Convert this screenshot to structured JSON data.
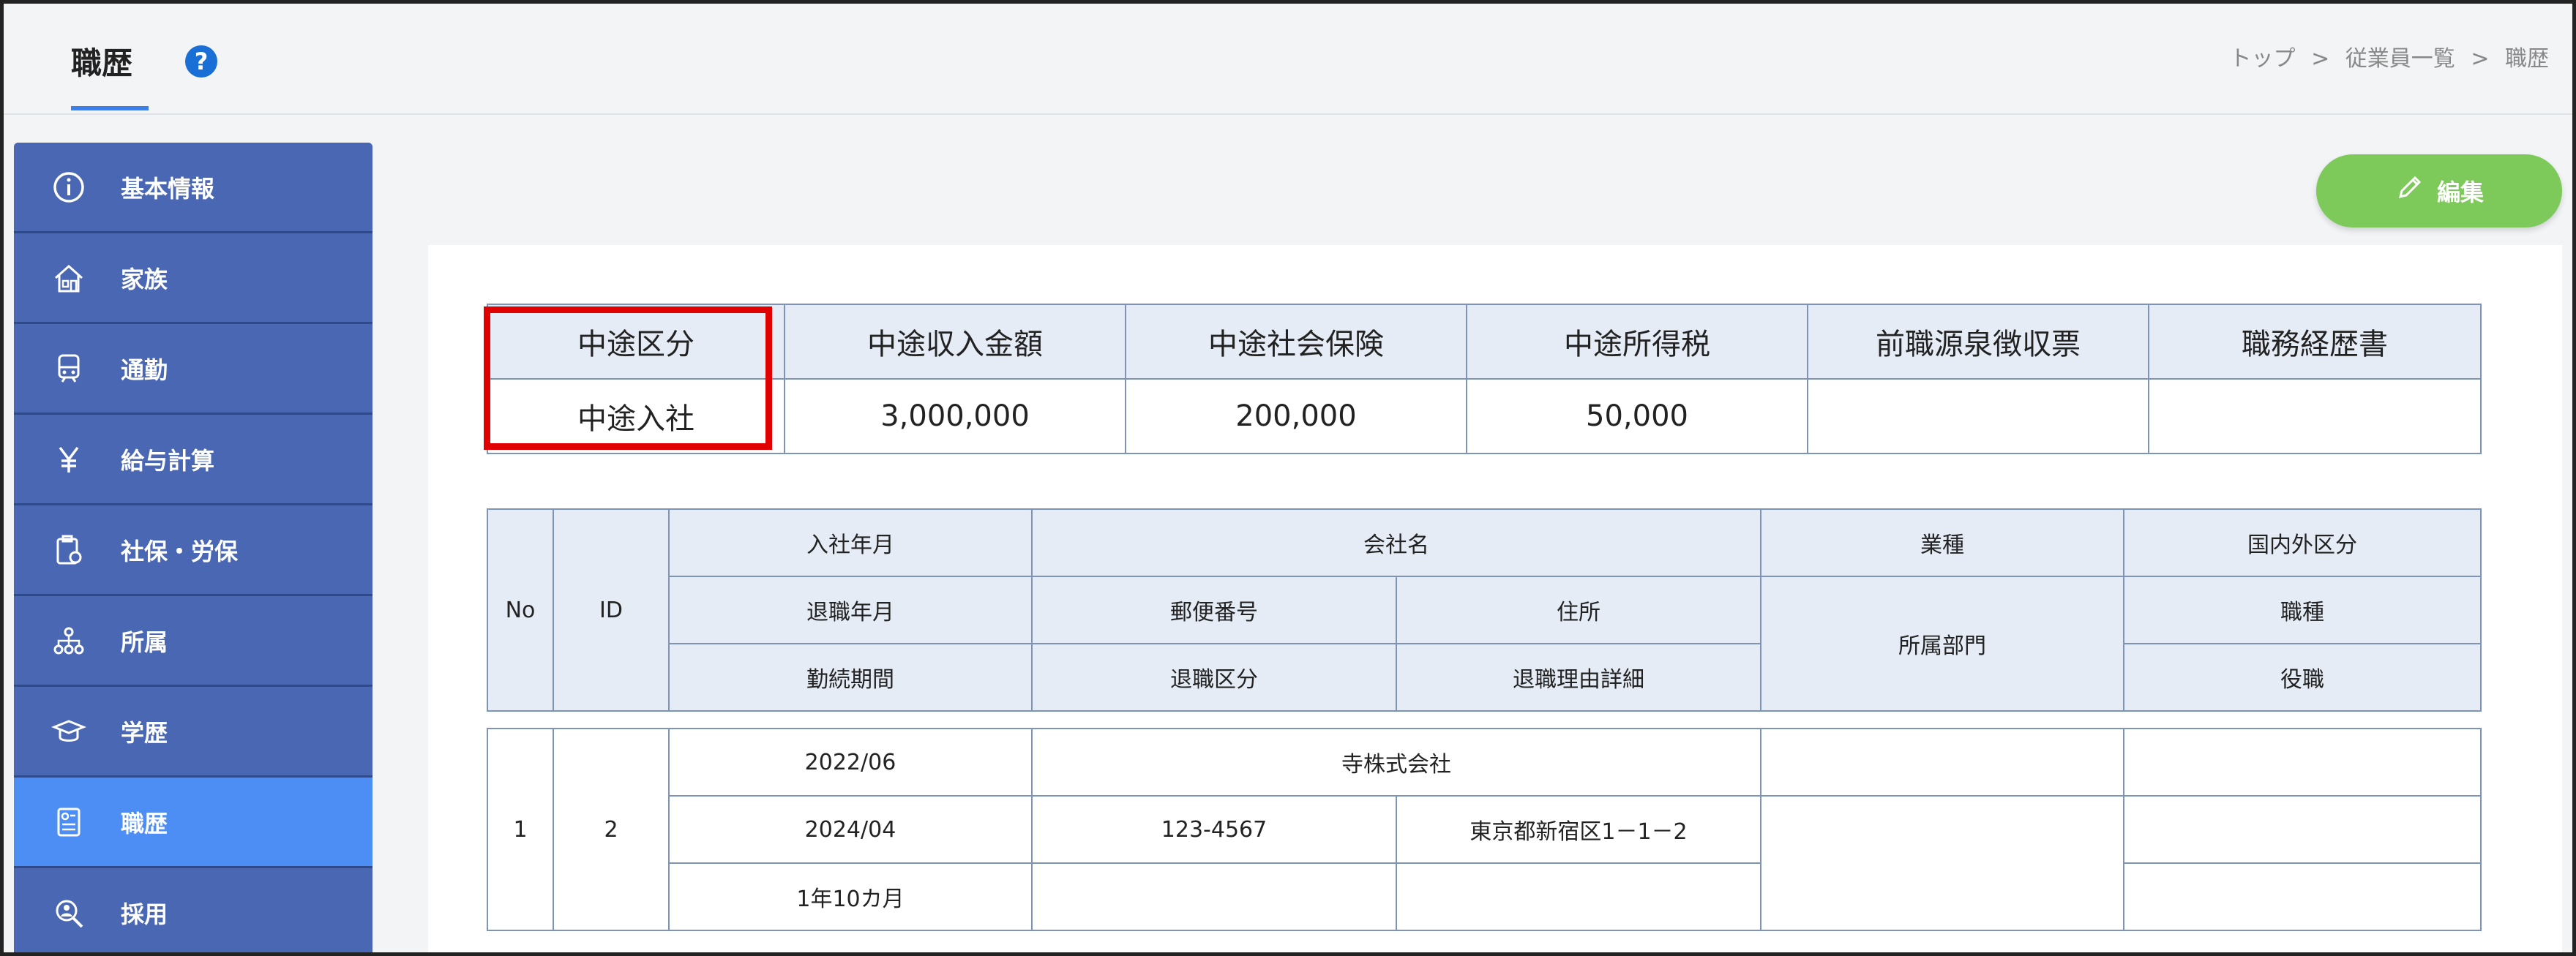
{
  "header": {
    "title": "職歴",
    "help_icon": "question-circle-icon",
    "breadcrumb": [
      "トップ",
      "従業員一覧",
      "職歴"
    ],
    "breadcrumb_sep": ">"
  },
  "sidebar": {
    "items": [
      {
        "label": "基本情報",
        "icon": "info-icon"
      },
      {
        "label": "家族",
        "icon": "house-icon"
      },
      {
        "label": "通勤",
        "icon": "train-icon"
      },
      {
        "label": "給与計算",
        "icon": "yen-icon"
      },
      {
        "label": "社保・労保",
        "icon": "clipboard-icon"
      },
      {
        "label": "所属",
        "icon": "org-chart-icon"
      },
      {
        "label": "学歴",
        "icon": "graduation-cap-icon"
      },
      {
        "label": "職歴",
        "icon": "resume-icon",
        "active": true
      },
      {
        "label": "採用",
        "icon": "search-person-icon"
      }
    ],
    "active_color": "#4d8ef5",
    "bg_color": "#4a67b4"
  },
  "edit_button": {
    "label": "編集",
    "icon": "pencil-icon",
    "color": "#7dc95a"
  },
  "summary_table": {
    "headers": [
      "中途区分",
      "中途収入金額",
      "中途社会保険",
      "中途所得税",
      "前職源泉徴収票",
      "職務経歴書"
    ],
    "values": [
      "中途入社",
      "3,000,000",
      "200,000",
      "50,000",
      "",
      ""
    ]
  },
  "history_table": {
    "header": {
      "no": "No",
      "id": "ID",
      "join_date": "入社年月",
      "company": "会社名",
      "industry": "業種",
      "domestic": "国内外区分",
      "leave_date": "退職年月",
      "postal": "郵便番号",
      "address": "住所",
      "department": "所属部門",
      "job_type": "職種",
      "tenure": "勤続期間",
      "leave_type": "退職区分",
      "leave_reason": "退職理由詳細",
      "position": "役職"
    },
    "rows": [
      {
        "no": "1",
        "id": "2",
        "join_date": "2022/06",
        "company": "寺株式会社",
        "industry": "",
        "domestic": "",
        "leave_date": "2024/04",
        "postal": "123-4567",
        "address": "東京都新宿区1－1－2",
        "department": "",
        "job_type": "",
        "tenure": "1年10カ月",
        "leave_type": "",
        "leave_reason": "",
        "position": ""
      }
    ]
  },
  "highlight_color": "#e00000"
}
